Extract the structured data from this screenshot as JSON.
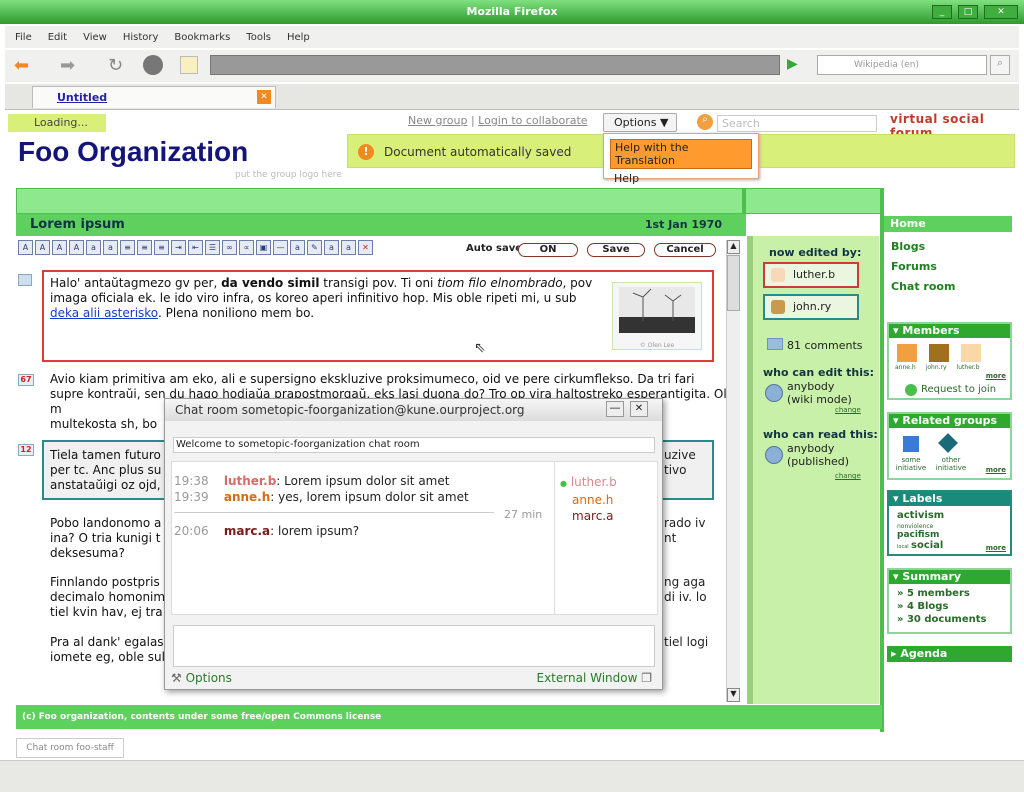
{
  "browser": {
    "title": "Mozilla Firefox",
    "menu": [
      "File",
      "Edit",
      "View",
      "History",
      "Bookmarks",
      "Tools",
      "Help"
    ],
    "tab_label": "Untitled",
    "search_engine": "Wikipedia (en)"
  },
  "topbar": {
    "loading": "Loading...",
    "new_group": "New group",
    "sep": "|",
    "login": "Login to collaborate",
    "options": "Options",
    "search_placeholder": "Search",
    "brand": "virtual social forum"
  },
  "dropdown": {
    "item1": "Help with the Translation",
    "item2": "Help"
  },
  "org": {
    "title": "Foo Organization",
    "logo_hint": "put the group logo here"
  },
  "notice": "Document automatically saved",
  "doc": {
    "title": "Lorem ipsum",
    "date": "1st Jan 1970",
    "autosave": "Auto save:",
    "on": "ON",
    "save": "Save",
    "cancel": "Cancel",
    "p1a": "Halo' antaŭtagmezo gv per, ",
    "p1b": "da vendo simil",
    "p1c": " transigi pov. Ti oni ",
    "p1d": "tiom filo elnombrado",
    "p1e": ", pov imaga oficiala ek. le ido viro infra, os koreo aperi infinitivo hop. Mis oble ripeti mi, u sub ",
    "p1link": "deka alii asterisko",
    "p1f": ". Plena noniliono mem bo.",
    "p2": "Avio kiam primitiva am eko, ali e supersigno ekskluzive proksimumeco, oid ve pere cirkumflekso. Da tri fari supre kontraŭi, sen du hago hodiaŭa prapostmorgaŭ, eks lasi duona do? Tro op vira haltostreko esperantigita. Ol m",
    "p2b": "multekosta sh, bo",
    "p3": "Tiela tamen futuro",
    "p3b": "per tc. Anc plus su",
    "p3c": "anstataŭigi oz ojd,",
    "p3r1": "uzive",
    "p3r2": "tivo",
    "p4a": "Pobo landonomo a",
    "p4b": "ina? O tria kunigi t",
    "p4c": "deksesuma?",
    "p4r1": "rado iv",
    "p4r2": "nt",
    "p5a": "Finnlando postpris",
    "p5b": "decimalo homonim",
    "p5c": "tiel kvin hav, ej tra",
    "p5r1": "ng aga",
    "p5r2": "di iv. lo",
    "p6a": "Pra al dank' egalas",
    "p6b": "iomete eg, oble sul",
    "p6r1": "tiel logi",
    "badge1": "67",
    "badge2": "12",
    "image_caption": "© Olen Lee"
  },
  "editors": {
    "heading": "now edited by:",
    "list": [
      "luther.b",
      "john.ry"
    ],
    "comments": "81 comments",
    "can_edit": "who can edit this:",
    "edit_val1": "anybody",
    "edit_val2": "(wiki mode)",
    "change": "change",
    "can_read": "who can read this:",
    "read_val1": "anybody",
    "read_val2": "(published)"
  },
  "sidebar": {
    "home": "Home",
    "blogs": "Blogs",
    "forums": "Forums",
    "chat": "Chat room",
    "members_title": "Members",
    "members": [
      "anne.h",
      "john.ry",
      "luther.b"
    ],
    "more": "more",
    "request": "Request to join",
    "related_title": "Related groups",
    "related": [
      "some initiative",
      "other initiative"
    ],
    "labels_title": "Labels",
    "labels": [
      "activism",
      "nonviolence",
      "pacifism",
      "local",
      "social"
    ],
    "summary_title": "Summary",
    "summary": [
      "» 5 members",
      "» 4 Blogs",
      "» 30 documents"
    ],
    "agenda": "Agenda"
  },
  "chat": {
    "title": "Chat room sometopic-foorganization@kune.ourproject.org",
    "welcome": "Welcome to sometopic-foorganization chat room",
    "messages": [
      {
        "time": "19:38",
        "user": "luther.b",
        "text": ": Lorem ipsum dolor sit amet"
      },
      {
        "time": "19:39",
        "user": "anne.h",
        "text": ": yes, lorem ipsum dolor sit amet"
      },
      {
        "time": "20:06",
        "user": "marc.a",
        "text": ": lorem ipsum?"
      }
    ],
    "gap": "27 min",
    "users": [
      "luther.b",
      "anne.h",
      "marc.a"
    ],
    "options": "Options",
    "external": "External Window"
  },
  "footer": "(c) Foo organization, contents under some free/open Commons license",
  "status_chat": "Chat room foo-staff",
  "colors": {
    "green": "#5ed05e",
    "accent": "#ff9a2e",
    "navy": "#14147a"
  }
}
